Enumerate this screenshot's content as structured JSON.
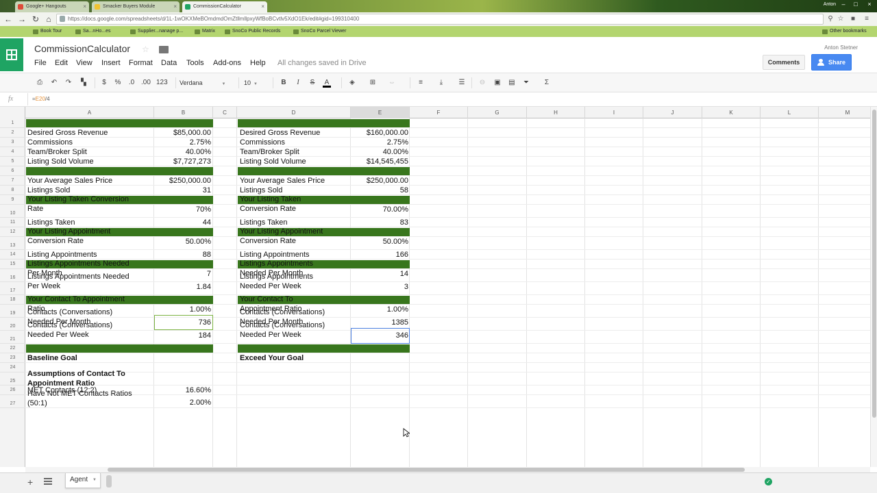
{
  "browser": {
    "tabs": [
      {
        "label": "Google+ Hangouts",
        "color": "#dd4b39"
      },
      {
        "label": "Smacker Buyers Module",
        "color": "#f1c232"
      },
      {
        "label": "CommissionCalculator",
        "color": "#1fa463",
        "active": true
      }
    ],
    "profile_name": "Anton",
    "url": "https://docs.google.com/spreadsheets/d/1L-1wOKXMeBOmdmdOmZtllmllpxyWfBoBCvtlv5XdO1Ek/edit#gid=199310400",
    "bookmarks": [
      "Book Tour",
      "Sa...nHo...es",
      "Supplier...nanage p...",
      "Matrix",
      "SnoCo Public Records",
      "SnoCo Parcel Viewer"
    ],
    "other_bookmarks": "Other bookmarks"
  },
  "doc": {
    "title": "CommissionCalculator",
    "menu": [
      "File",
      "Edit",
      "View",
      "Insert",
      "Format",
      "Data",
      "Tools",
      "Add-ons",
      "Help"
    ],
    "save_status": "All changes saved in Drive",
    "account_name": "Anton Stetner",
    "comments_label": "Comments",
    "share_label": "Share"
  },
  "toolbar": {
    "number_format_labels": [
      "$",
      "%",
      ".0",
      ".00",
      "123"
    ],
    "font": "Verdana",
    "font_size": "10",
    "bold": "B",
    "italic": "I",
    "strikethrough": "S",
    "text_color": "A",
    "sum": "Σ"
  },
  "formula_bar": {
    "fx": "fx",
    "prefix": "=",
    "ref": "E20",
    "suffix": "/4"
  },
  "grid": {
    "columns": [
      "A",
      "B",
      "C",
      "D",
      "E",
      "F",
      "G",
      "H",
      "I",
      "J",
      "K",
      "L",
      "M"
    ],
    "selected_column": "E",
    "rows": [
      "1",
      "2",
      "3",
      "4",
      "5",
      "6",
      "7",
      "8",
      "9",
      "10",
      "11",
      "12",
      "13",
      "14",
      "15",
      "16",
      "17",
      "18",
      "19",
      "20",
      "21",
      "22",
      "23",
      "24",
      "25",
      "26",
      "27"
    ],
    "left_table": [
      {
        "row": 2,
        "label": "Desired Gross Revenue",
        "value": "$85,000.00"
      },
      {
        "row": 3,
        "label": "Commissions",
        "value": "2.75%"
      },
      {
        "row": 4,
        "label": "Team/Broker Split",
        "value": "40.00%"
      },
      {
        "row": 5,
        "label": "Listing Sold Volume",
        "value": "$7,727,273"
      },
      {
        "row": 7,
        "label": "Your Average Sales Price",
        "value": "$250,000.00"
      },
      {
        "row": 8,
        "label": "Listings Sold",
        "value": "31"
      },
      {
        "row": 10,
        "label": "Your Listing Taken Conversion\nRate",
        "value": "70%"
      },
      {
        "row": 11,
        "label": "Listings Taken",
        "value": "44"
      },
      {
        "row": 13,
        "label": "Your Listing Appointment\nConversion Rate",
        "value": "50.00%"
      },
      {
        "row": 14,
        "label": "Listing Appointments",
        "value": "88"
      },
      {
        "row": 16,
        "label": "Listings Appointments Needed\nPer Month",
        "value": "7"
      },
      {
        "row": 17,
        "label": "Listings Appointments Needed\nPer Week",
        "value": "1.84"
      },
      {
        "row": 19,
        "label": "Your Contact To Appointment\nRatio",
        "value": "1.00%"
      },
      {
        "row": 20,
        "label": "Contacts (Conversations)\nNeeded Per Month",
        "value": "736"
      },
      {
        "row": 21,
        "label": "Contacts (Conversations)\nNeeded Per Week",
        "value": "184"
      }
    ],
    "right_table": [
      {
        "row": 2,
        "label": "Desired Gross Revenue",
        "value": "$160,000.00"
      },
      {
        "row": 3,
        "label": "Commissions",
        "value": "2.75%"
      },
      {
        "row": 4,
        "label": "Team/Broker Split",
        "value": "40.00%"
      },
      {
        "row": 5,
        "label": "Listing Sold Volume",
        "value": "$14,545,455"
      },
      {
        "row": 7,
        "label": "Your Average Sales Price",
        "value": "$250,000.00"
      },
      {
        "row": 8,
        "label": "Listings Sold",
        "value": "58"
      },
      {
        "row": 10,
        "label": "Your Listing Taken\nConversion Rate",
        "value": "70.00%"
      },
      {
        "row": 11,
        "label": "Listings Taken",
        "value": "83"
      },
      {
        "row": 13,
        "label": "Your Listing Appointment\nConversion Rate",
        "value": "50.00%"
      },
      {
        "row": 14,
        "label": "Listing Appointments",
        "value": "166"
      },
      {
        "row": 16,
        "label": "Listings Appointments\nNeeded Per Month",
        "value": "14"
      },
      {
        "row": 17,
        "label": "Listings Appointments\nNeeded Per Week",
        "value": "3"
      },
      {
        "row": 19,
        "label": "Your Contact To\nAppointment Ratio",
        "value": "1.00%"
      },
      {
        "row": 20,
        "label": "Contacts (Conversations)\nNeeded Per Month",
        "value": "1385"
      },
      {
        "row": 21,
        "label": "Contacts (Conversations)\nNeeded Per Week",
        "value": "346"
      }
    ],
    "goals": {
      "left": "Baseline Goal",
      "right": "Exceed Your Goal"
    },
    "assumptions": {
      "heading": "Assumptions of Contact To\nAppointment Ratio",
      "items": [
        {
          "label": "MET Contacts (12:2)",
          "value": "16.60%"
        },
        {
          "label": "Have Not MET Contacts Ratios\n(50:1)",
          "value": "2.00%"
        }
      ]
    },
    "band_color": "#38761d"
  },
  "sheet_tabs": {
    "active": "Agent"
  }
}
